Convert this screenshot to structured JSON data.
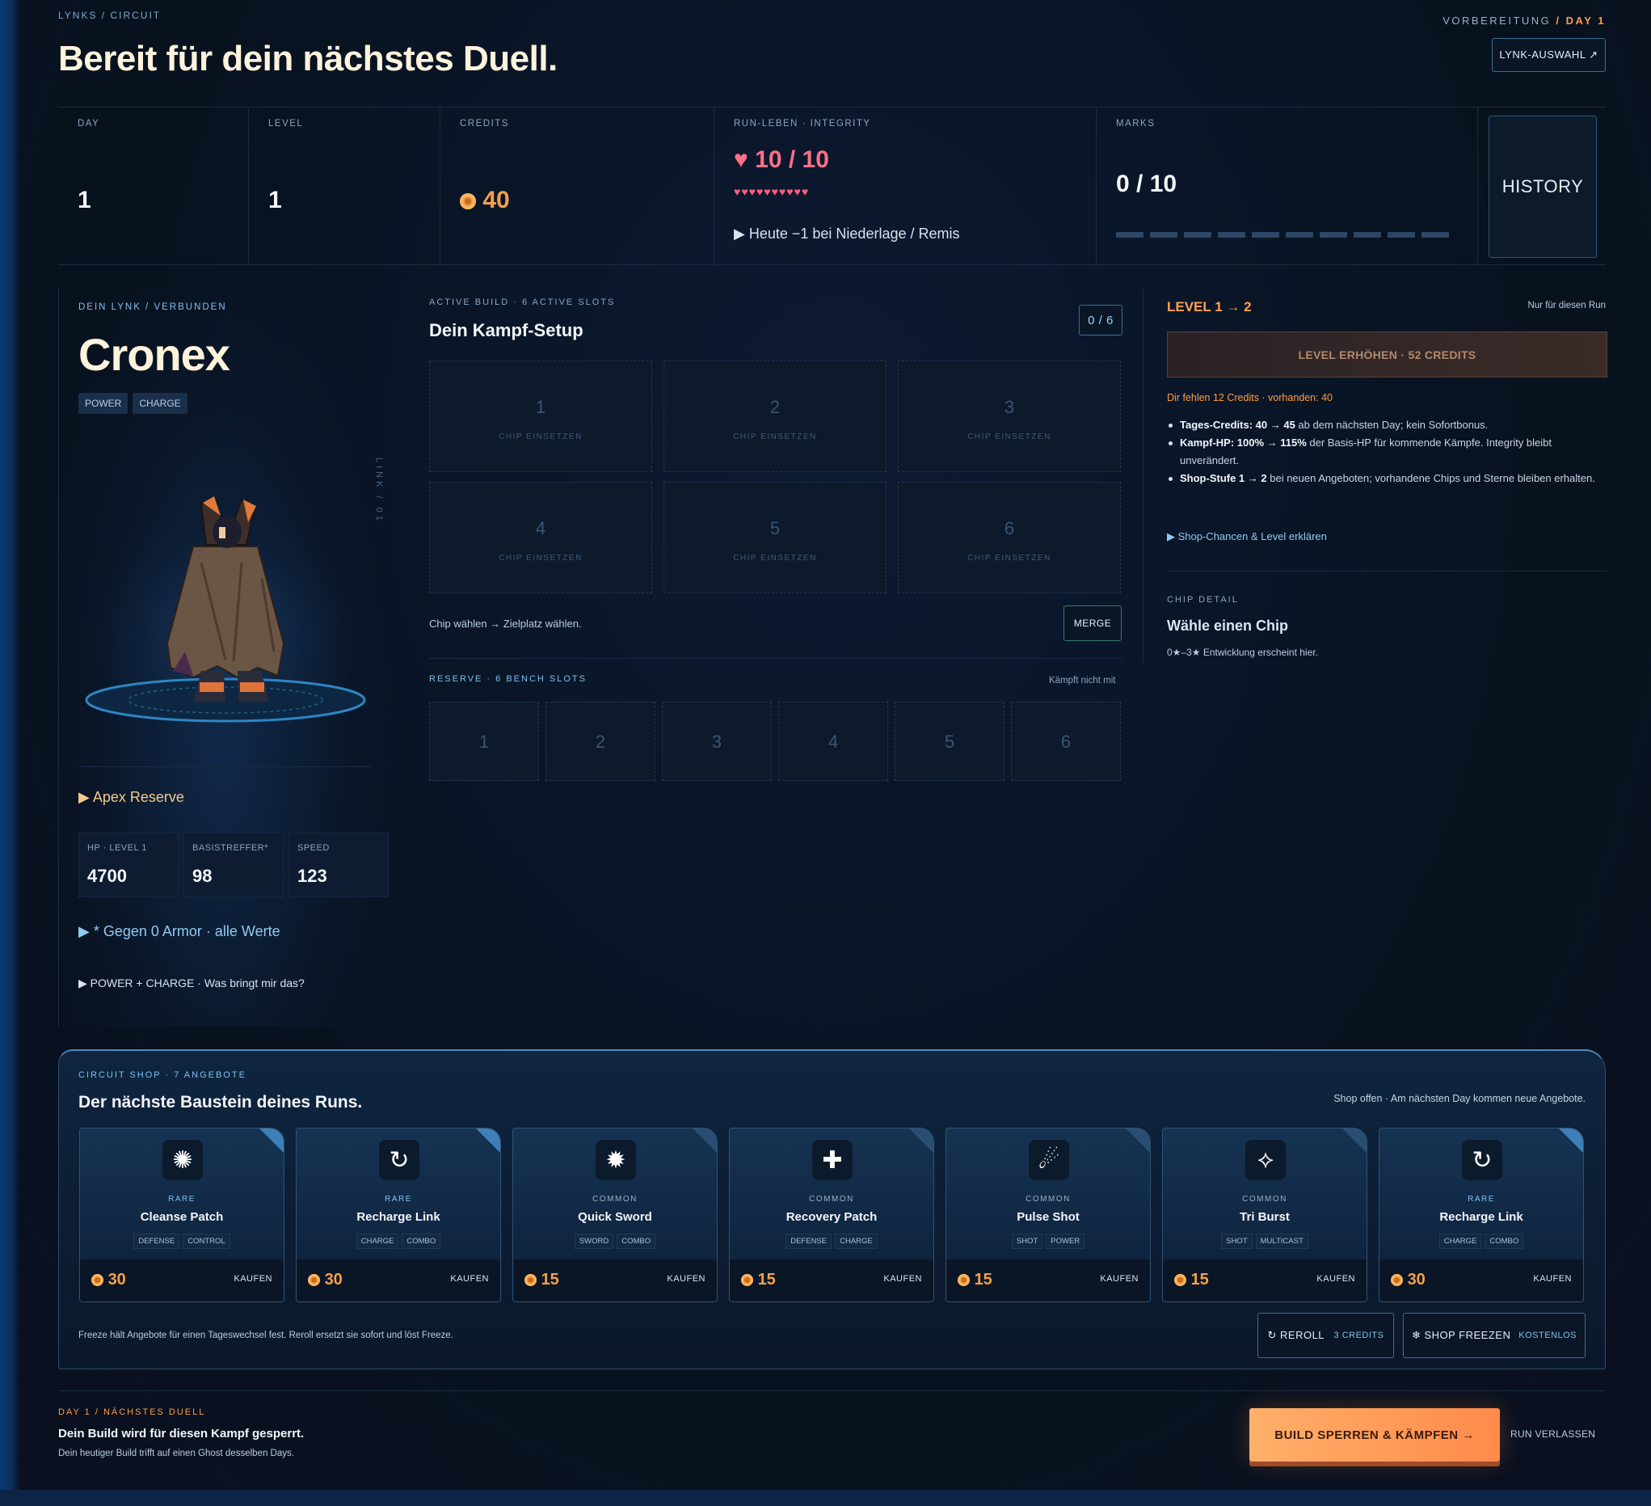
{
  "header": {
    "breadcrumb": "LYNKS / CIRCUIT",
    "title": "Bereit für dein nächstes Duell.",
    "phase_prefix": "VORBEREITUNG",
    "phase_day": "/ DAY 1",
    "lynk_select_label": "LYNK-AUSWAHL ↗"
  },
  "stats": {
    "day": {
      "label": "DAY",
      "value": "1"
    },
    "level": {
      "label": "LEVEL",
      "value": "1"
    },
    "credits": {
      "label": "CREDITS",
      "value": "40"
    },
    "integrity": {
      "label": "RUN-LEBEN · INTEGRITY",
      "value": "♥ 10 / 10",
      "hearts": "♥♥♥♥♥♥♥♥♥♥",
      "hint": "▶ Heute −1 bei Niederlage / Remis"
    },
    "marks": {
      "label": "MARKS",
      "value": "0 / 10",
      "filled": 0,
      "total": 10
    },
    "history_label": "HISTORY"
  },
  "lynk": {
    "label": "DEIN LYNK / VERBUNDEN",
    "name": "Cronex",
    "tags": [
      "POWER",
      "CHARGE"
    ],
    "vertical_label": "LINK / 01",
    "reserve_toggle": "▶ Apex Reserve",
    "values": [
      {
        "label": "HP · LEVEL 1",
        "value": "4700"
      },
      {
        "label": "BASISTREFFER*",
        "value": "98"
      },
      {
        "label": "SPEED",
        "value": "123"
      }
    ],
    "armor_toggle": "▶ * Gegen 0 Armor · alle Werte",
    "synergy_toggle": "▶ POWER + CHARGE · Was bringt mir das?"
  },
  "build": {
    "eyebrow": "ACTIVE BUILD · 6 ACTIVE SLOTS",
    "title": "Dein Kampf-Setup",
    "counter": "0 / 6",
    "slot_label": "CHIP EINSETZEN",
    "slots": [
      "1",
      "2",
      "3",
      "4",
      "5",
      "6"
    ],
    "hint": "Chip wählen → Zielplatz wählen.",
    "merge_label": "MERGE",
    "reserve_eyebrow": "RESERVE · 6 BENCH SLOTS",
    "reserve_note": "Kämpft nicht mit",
    "bench": [
      "1",
      "2",
      "3",
      "4",
      "5",
      "6"
    ]
  },
  "levelup": {
    "title": "LEVEL 1 → 2",
    "note": "Nur für diesen Run",
    "button": "LEVEL ERHÖHEN · 52 CREDITS",
    "missing": "Dir fehlen 12 Credits · vorhanden: 40",
    "bullets": [
      {
        "bold": "Tages-Credits: 40 → 45",
        "text": " ab dem nächsten Day; kein Sofortbonus."
      },
      {
        "bold": "Kampf-HP: 100% → 115%",
        "text": " der Basis-HP für kommende Kämpfe. Integrity bleibt unverändert."
      },
      {
        "bold": "Shop-Stufe 1 → 2",
        "text": " bei neuen Angeboten; vorhandene Chips und Sterne bleiben erhalten."
      }
    ],
    "explain_link": "▶ Shop-Chancen & Level erklären"
  },
  "chip_detail": {
    "eyebrow": "CHIP DETAIL",
    "title": "Wähle einen Chip",
    "hint": "0★–3★ Entwicklung erscheint hier."
  },
  "shop": {
    "eyebrow": "CIRCUIT SHOP · 7 ANGEBOTE",
    "title": "Der nächste Baustein deines Runs.",
    "status": "Shop offen · Am nächsten Day kommen neue Angebote.",
    "buy_label": "KAUFEN",
    "offers": [
      {
        "rarity": "RARE",
        "name": "Cleanse Patch",
        "tags": [
          "DEFENSE",
          "CONTROL"
        ],
        "price": "30",
        "icon": "cleanse-icon",
        "glyph": "✺"
      },
      {
        "rarity": "RARE",
        "name": "Recharge Link",
        "tags": [
          "CHARGE",
          "COMBO"
        ],
        "price": "30",
        "icon": "recharge-icon",
        "glyph": "↻"
      },
      {
        "rarity": "COMMON",
        "name": "Quick Sword",
        "tags": [
          "SWORD",
          "COMBO"
        ],
        "price": "15",
        "icon": "sword-icon",
        "glyph": "✹"
      },
      {
        "rarity": "COMMON",
        "name": "Recovery Patch",
        "tags": [
          "DEFENSE",
          "CHARGE"
        ],
        "price": "15",
        "icon": "recovery-icon",
        "glyph": "✚"
      },
      {
        "rarity": "COMMON",
        "name": "Pulse Shot",
        "tags": [
          "SHOT",
          "POWER"
        ],
        "price": "15",
        "icon": "pulse-shot-icon",
        "glyph": "☄"
      },
      {
        "rarity": "COMMON",
        "name": "Tri Burst",
        "tags": [
          "SHOT",
          "MULTICAST"
        ],
        "price": "15",
        "icon": "tri-burst-icon",
        "glyph": "⟡"
      },
      {
        "rarity": "RARE",
        "name": "Recharge Link",
        "tags": [
          "CHARGE",
          "COMBO"
        ],
        "price": "30",
        "icon": "recharge-icon",
        "glyph": "↻"
      }
    ],
    "footer_note": "Freeze hält Angebote für einen Tageswechsel fest. Reroll ersetzt sie sofort und löst Freeze.",
    "reroll_label": "↻ REROLL",
    "reroll_cost": "3 CREDITS",
    "freeze_label": "❄ SHOP FREEZEN",
    "freeze_cost": "KOSTENLOS"
  },
  "footer": {
    "eyebrow": "DAY 1 / NÄCHSTES DUELL",
    "title": "Dein Build wird für diesen Kampf gesperrt.",
    "subtitle": "Dein heutiger Build trifft auf einen Ghost desselben Days.",
    "cta": "BUILD SPERREN & KÄMPFEN →",
    "leave": "RUN VERLASSEN"
  },
  "colors": {
    "accent_orange": "#ff9d45",
    "rare": "#7fc0ea",
    "common": "#9fb0c2",
    "heart": "#ff5d7a"
  }
}
